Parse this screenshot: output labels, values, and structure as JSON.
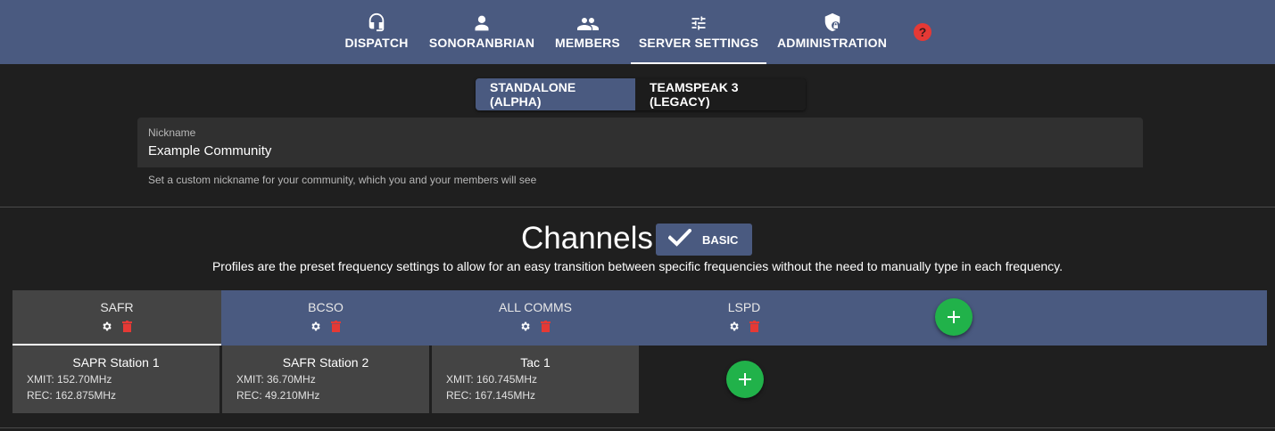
{
  "nav": {
    "items": [
      {
        "label": "DISPATCH",
        "icon": "headset-icon"
      },
      {
        "label": "SONORANBRIAN",
        "icon": "person-icon"
      },
      {
        "label": "MEMBERS",
        "icon": "group-icon"
      },
      {
        "label": "SERVER SETTINGS",
        "icon": "sliders-icon",
        "active": true
      },
      {
        "label": "ADMINISTRATION",
        "icon": "shield-lock-icon"
      }
    ],
    "help": "?"
  },
  "mode": {
    "standalone": "STANDALONE (ALPHA)",
    "teamspeak": "TEAMSPEAK 3 (LEGACY)",
    "selected": "STANDALONE (ALPHA)"
  },
  "nickname": {
    "label": "Nickname",
    "value": "Example Community",
    "helper": "Set a custom nickname for your community, which you and your members will see"
  },
  "channels": {
    "title": "Channels",
    "basic_label": "BASIC",
    "basic_checked": true,
    "subtitle": "Profiles are the preset frequency settings to allow for an easy transition between specific frequencies without the need to manually type in each frequency."
  },
  "profiles": [
    {
      "name": "SAFR",
      "active": true
    },
    {
      "name": "BCSO"
    },
    {
      "name": "ALL COMMS"
    },
    {
      "name": "LSPD"
    }
  ],
  "channel_cards": [
    {
      "name": "SAPR Station 1",
      "xmit": "XMIT: 152.70MHz",
      "rec": "REC: 162.875MHz"
    },
    {
      "name": "SAFR Station 2",
      "xmit": "XMIT: 36.70MHz",
      "rec": "REC: 49.210MHz"
    },
    {
      "name": "Tac 1",
      "xmit": "XMIT: 160.745MHz",
      "rec": "REC: 167.145MHz"
    }
  ],
  "colors": {
    "nav_bg": "#4a5a80",
    "page_bg": "#1f1f1f",
    "add_green": "#21b24a",
    "delete_red": "#e53935",
    "card_bg": "#444444"
  }
}
